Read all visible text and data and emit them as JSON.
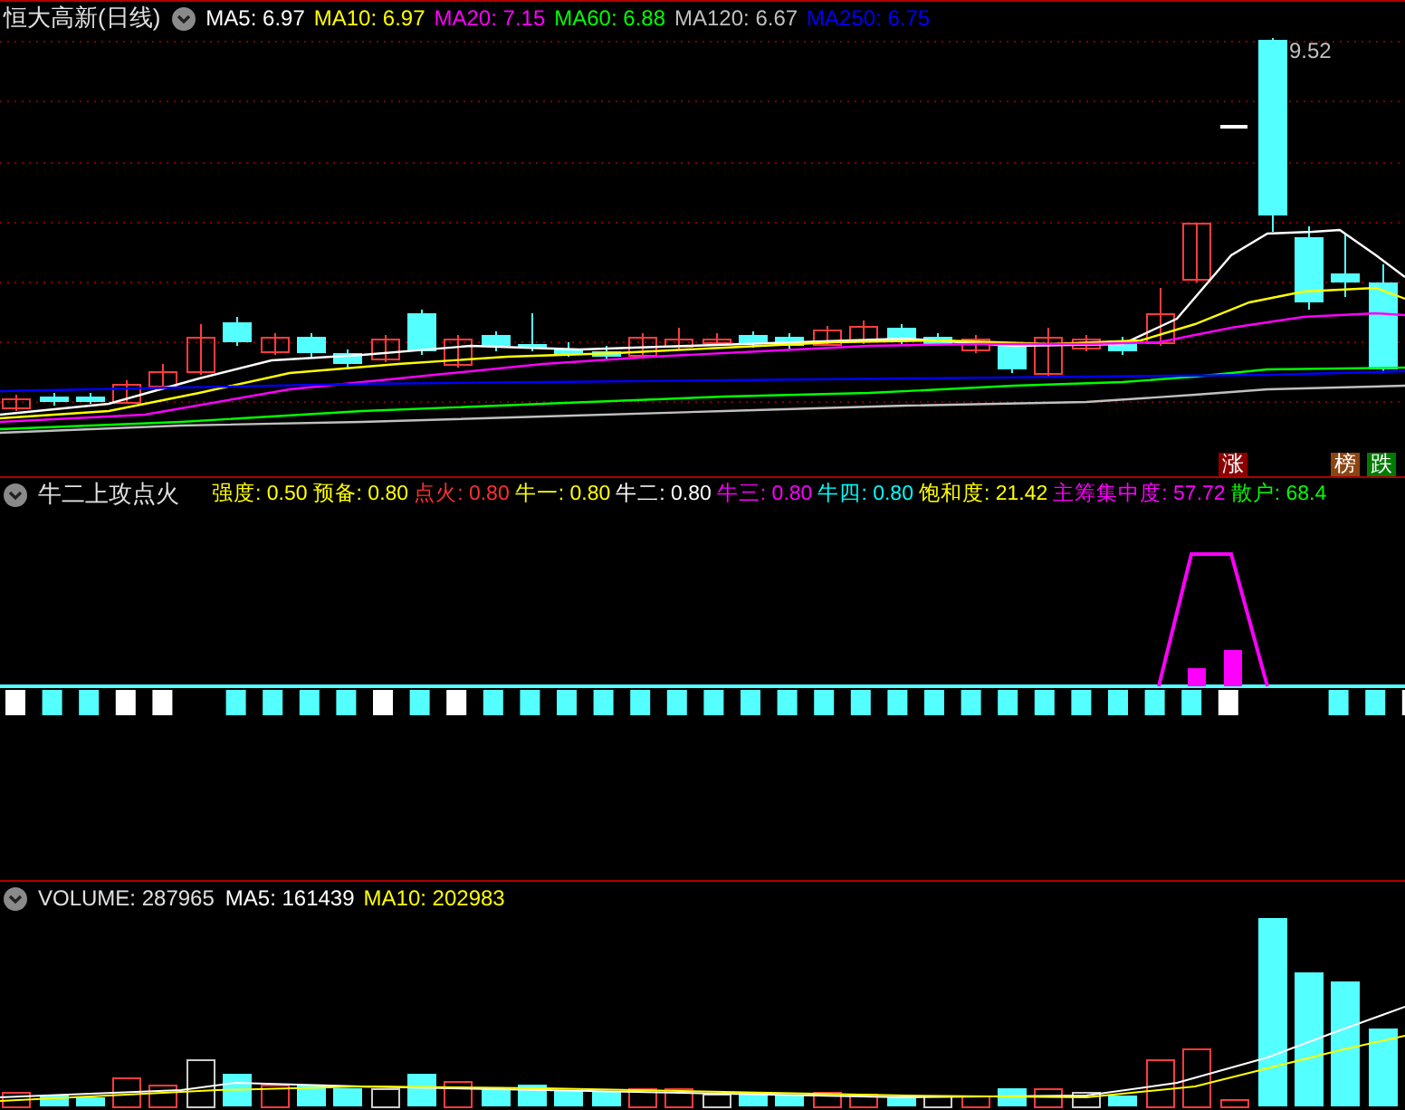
{
  "panels": [
    {
      "kind": "price",
      "title": "恒大高新(日线)",
      "indicators": [
        {
          "label": "MA5: 6.97",
          "color": "#ffffff"
        },
        {
          "label": "MA10: 6.97",
          "color": "#ffff00"
        },
        {
          "label": "MA20: 7.15",
          "color": "#ff00ff"
        },
        {
          "label": "MA60: 6.88",
          "color": "#00ff00"
        },
        {
          "label": "MA120: 6.67",
          "color": "#c0c0c0"
        },
        {
          "label": "MA250: 6.75",
          "color": "#0000ff"
        }
      ],
      "high_label": "9.52",
      "markers": [
        {
          "text": "涨",
          "color": "#8b0000"
        },
        {
          "text": "榜",
          "color": "#8b4513"
        },
        {
          "text": "跌",
          "color": "#007a00"
        }
      ]
    },
    {
      "kind": "signal",
      "title": "牛二上攻点火",
      "indicators": [
        {
          "label": "强度: 0.50",
          "color": "#ffff00"
        },
        {
          "label": "预备: 0.80",
          "color": "#ffff00"
        },
        {
          "label": "点火: 0.80",
          "color": "#ff3030"
        },
        {
          "label": "牛一: 0.80",
          "color": "#ffff00"
        },
        {
          "label": "牛二: 0.80",
          "color": "#ffffff"
        },
        {
          "label": "牛三: 0.80",
          "color": "#ff00ff"
        },
        {
          "label": "牛四: 0.80",
          "color": "#00ffff"
        },
        {
          "label": "饱和度: 21.42",
          "color": "#ffff00"
        },
        {
          "label": "主筹集中度: 57.72",
          "color": "#ff00ff"
        },
        {
          "label": "散户: 68.4",
          "color": "#00ff00"
        }
      ]
    },
    {
      "kind": "volume",
      "title": "VOLUME: 287965",
      "indicators": [
        {
          "label": "MA5: 161439",
          "color": "#ffffff"
        },
        {
          "label": "MA10: 202983",
          "color": "#ffff00"
        }
      ]
    }
  ]
}
